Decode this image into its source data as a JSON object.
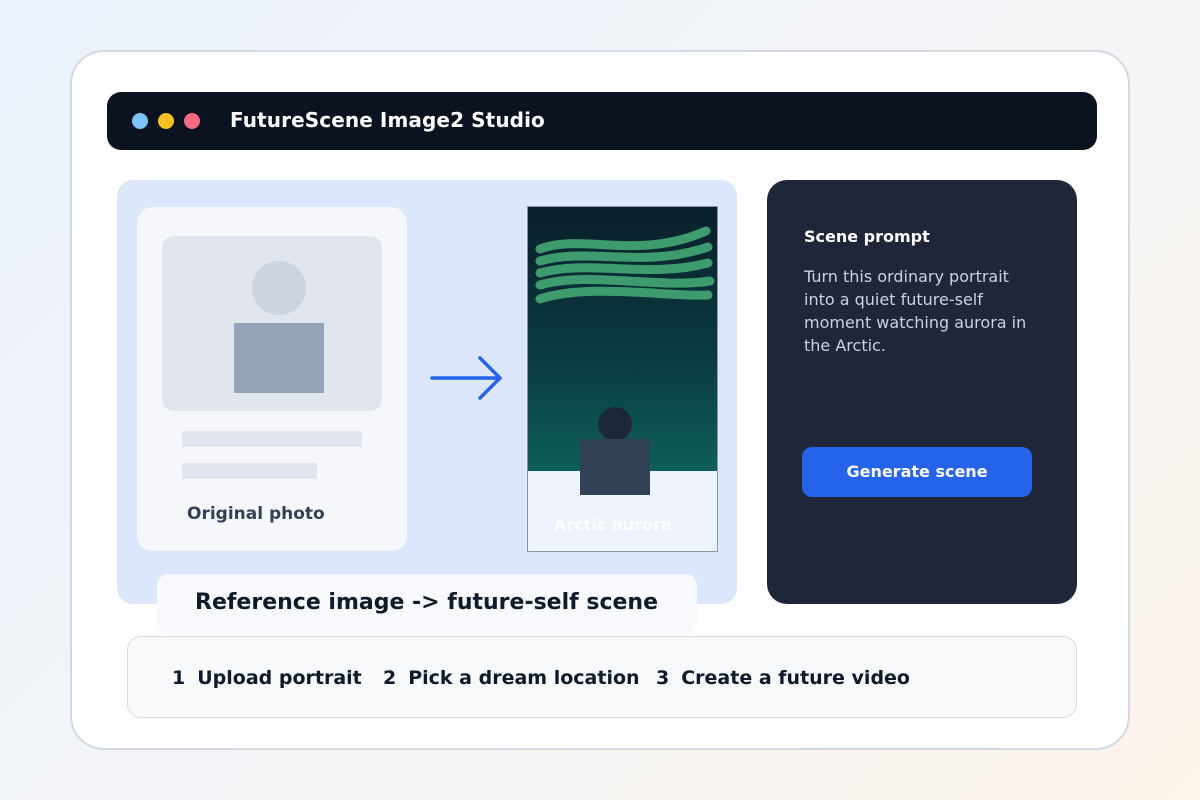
{
  "window": {
    "title": "FutureScene Image2 Studio",
    "controls": [
      "close-dot",
      "minimize-dot",
      "maximize-dot"
    ]
  },
  "canvas": {
    "original_card": {
      "label": "Original photo"
    },
    "result_card": {
      "label": "Arctic aurora"
    },
    "caption": "Reference image -> future-self scene"
  },
  "prompt_panel": {
    "heading": "Scene prompt",
    "text": "Turn this ordinary portrait into a quiet future-self moment watching aurora in the Arctic.",
    "button_label": "Generate scene"
  },
  "steps": [
    {
      "number": "1",
      "label": "Upload portrait"
    },
    {
      "number": "2",
      "label": "Pick a dream location"
    },
    {
      "number": "3",
      "label": "Create a future video"
    }
  ],
  "colors": {
    "titlebar": "#0b1220",
    "accent": "#2563eb",
    "dot_blue": "#7cc6f7",
    "dot_yellow": "#f7c21b",
    "dot_pink": "#f06a80",
    "aurora_green": "#3e9b6e"
  }
}
